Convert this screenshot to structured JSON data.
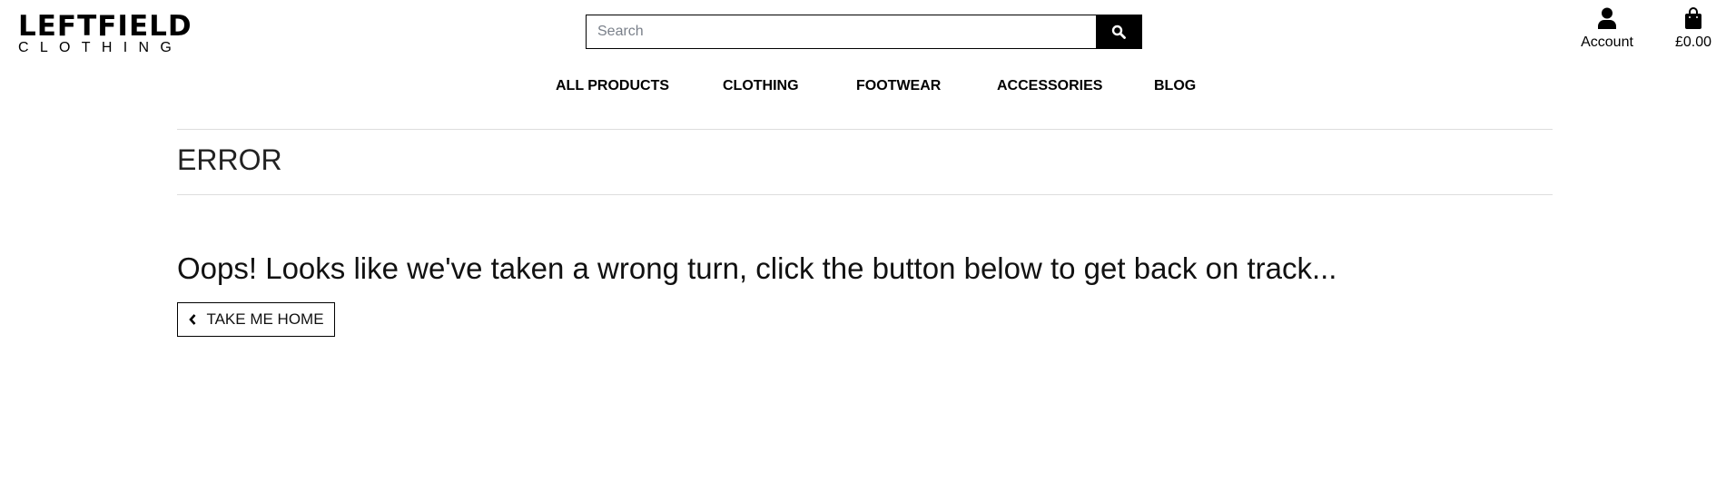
{
  "logo": {
    "line1": "LEFTFIELD",
    "line2": "CLOTHING"
  },
  "search": {
    "placeholder": "Search",
    "icon": "search-icon"
  },
  "account": {
    "label": "Account",
    "icon": "user-icon"
  },
  "cart": {
    "total": "£0.00",
    "icon": "shopping-bag-icon"
  },
  "nav": [
    "ALL PRODUCTS",
    "CLOTHING",
    "FOOTWEAR",
    "ACCESSORIES",
    "BLOG"
  ],
  "page": {
    "title": "ERROR",
    "message": "Oops! Looks like we've taken a wrong turn, click the button below to get back on track...",
    "button": "TAKE ME HOME",
    "button_icon": "chevron-left-icon"
  }
}
